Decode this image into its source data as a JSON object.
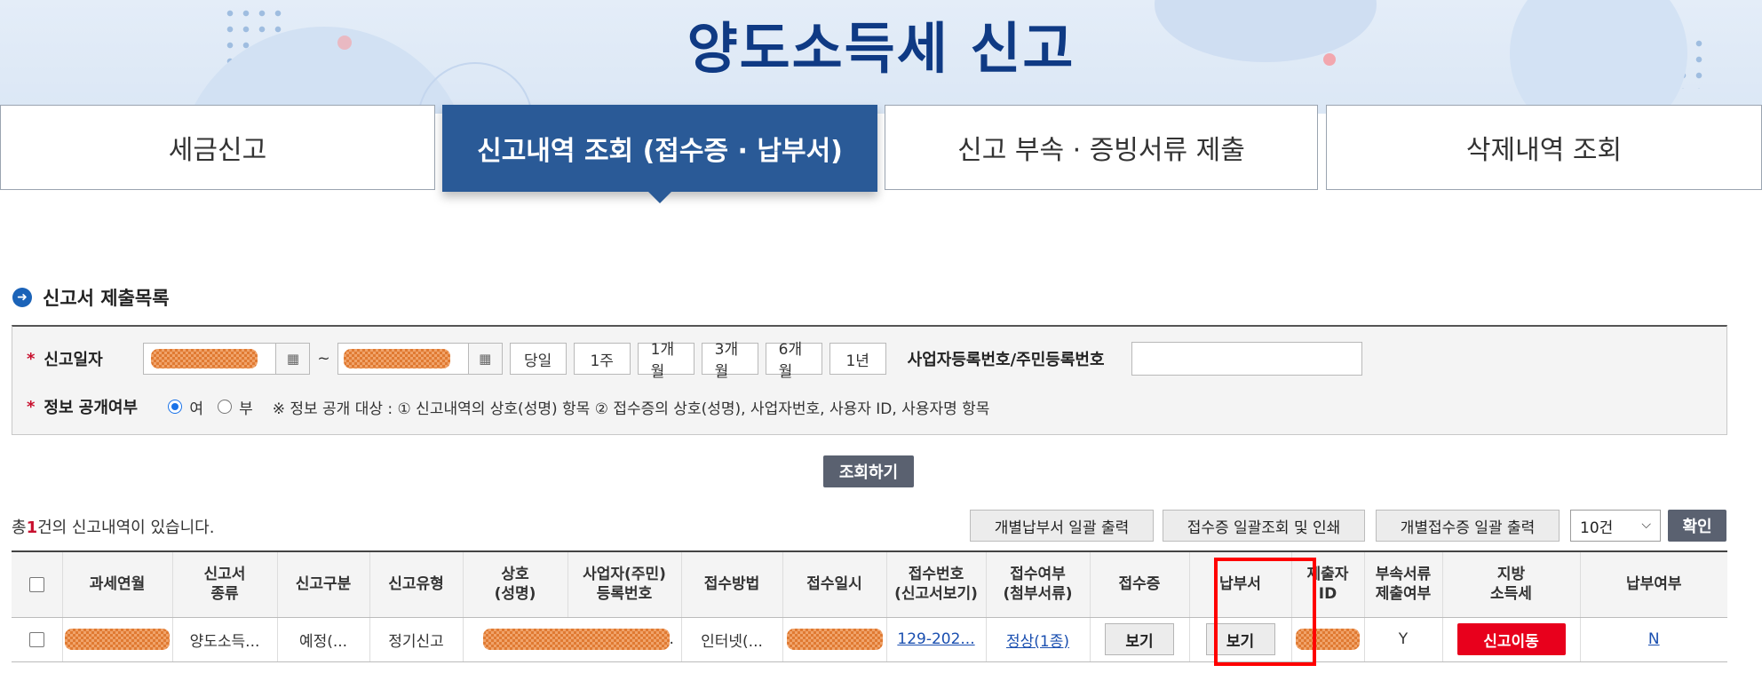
{
  "header": {
    "title": "양도소득세 신고"
  },
  "tabs": [
    {
      "label": "세금신고"
    },
    {
      "label": "신고내역 조회 (접수증 · 납부서)"
    },
    {
      "label": "신고 부속 · 증빙서류 제출"
    },
    {
      "label": "삭제내역 조회"
    }
  ],
  "section": {
    "title": "신고서 제출목록"
  },
  "search": {
    "date_label": "신고일자",
    "tilde": "~",
    "period_buttons": [
      "당일",
      "1주",
      "1개월",
      "3개월",
      "6개월",
      "1년"
    ],
    "regno_label": "사업자등록번호/주민등록번호",
    "disclosure_label": "정보 공개여부",
    "radio_yes": "여",
    "radio_no": "부",
    "disclosure_note": "※ 정보 공개 대상 : ① 신고내역의 상호(성명) 항목 ② 접수증의 상호(성명), 사업자번호, 사용자 ID, 사용자명 항목",
    "search_button": "조회하기"
  },
  "results": {
    "count_prefix": "총",
    "count": "1",
    "count_suffix": "건의 신고내역이 있습니다.",
    "btn_bulk_payment": "개별납부서 일괄 출력",
    "btn_bulk_receipt": "접수증 일괄조회 및 인쇄",
    "btn_bulk_individual_receipt": "개별접수증 일괄 출력",
    "page_size": "10건",
    "confirm": "확인"
  },
  "table": {
    "headers": [
      "",
      "과세연월",
      "신고서\n종류",
      "신고구분",
      "신고유형",
      "상호\n(성명)",
      "사업자(주민)\n등록번호",
      "접수방법",
      "접수일시",
      "접수번호\n(신고서보기)",
      "접수여부\n(첨부서류)",
      "접수증",
      "납부서",
      "제출자\nID",
      "부속서류\n제출여부",
      "지방\n소득세",
      "납부여부"
    ],
    "row": {
      "type": "양도소득...",
      "category": "예정(...",
      "filing_type": "정기신고",
      "method": "인터넷(...",
      "receipt_no": "129-202...",
      "status": "정상(1종)",
      "receipt_btn": "보기",
      "payment_btn": "보기",
      "attach": "Y",
      "local_tax_btn": "신고이동",
      "paid": "N"
    }
  },
  "colors": {
    "brand": "#0f3a84",
    "tab_active": "#2a5a97",
    "alert": "#e8001c",
    "highlight": "#ff0000"
  }
}
